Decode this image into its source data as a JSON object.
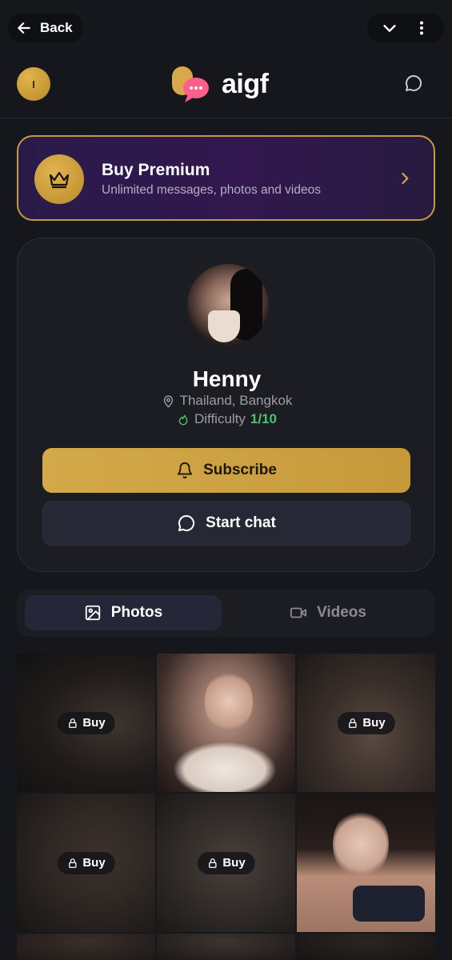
{
  "topbar": {
    "back_label": "Back"
  },
  "header": {
    "avatar_initial": "I",
    "logo_text": "aigf"
  },
  "premium": {
    "title": "Buy Premium",
    "subtitle": "Unlimited messages, photos and videos"
  },
  "profile": {
    "name": "Henny",
    "location": "Thailand, Bangkok",
    "difficulty_label": "Difficulty",
    "difficulty_value": "1/10",
    "subscribe_label": "Subscribe",
    "start_chat_label": "Start chat"
  },
  "tabs": [
    {
      "label": "Photos",
      "active": true
    },
    {
      "label": "Videos",
      "active": false
    }
  ],
  "grid": {
    "buy_label": "Buy",
    "items": [
      {
        "locked": true
      },
      {
        "locked": false
      },
      {
        "locked": true
      },
      {
        "locked": true
      },
      {
        "locked": true
      },
      {
        "locked": false
      }
    ]
  },
  "colors": {
    "background": "#16171c",
    "gold": "#d4a94a",
    "premium_purple": "#2a1a4a",
    "difficulty_green": "#4cc56a"
  }
}
